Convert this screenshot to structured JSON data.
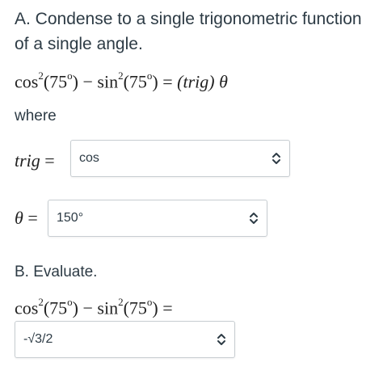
{
  "part_a": {
    "prompt": "A. Condense to a single trigonometric function of a single angle.",
    "equation": {
      "cos": "cos",
      "exp": "2",
      "arg": "(75",
      "deg": "o",
      "close": ")",
      "minus": " − ",
      "sin": "sin",
      "equals": " = ",
      "trig_lhs": "(trig)",
      "theta": "θ"
    },
    "where_label": "where",
    "trig_label": "trig",
    "equals_sign": "=",
    "trig_select": {
      "value": "cos",
      "icon": "chevron-up-down-icon"
    },
    "theta_label": "θ",
    "theta_select": {
      "value": "150°",
      "icon": "chevron-up-down-icon"
    }
  },
  "part_b": {
    "prompt": "B. Evaluate.",
    "answer_select": {
      "value": "-√3/2",
      "icon": "chevron-up-down-icon"
    }
  }
}
